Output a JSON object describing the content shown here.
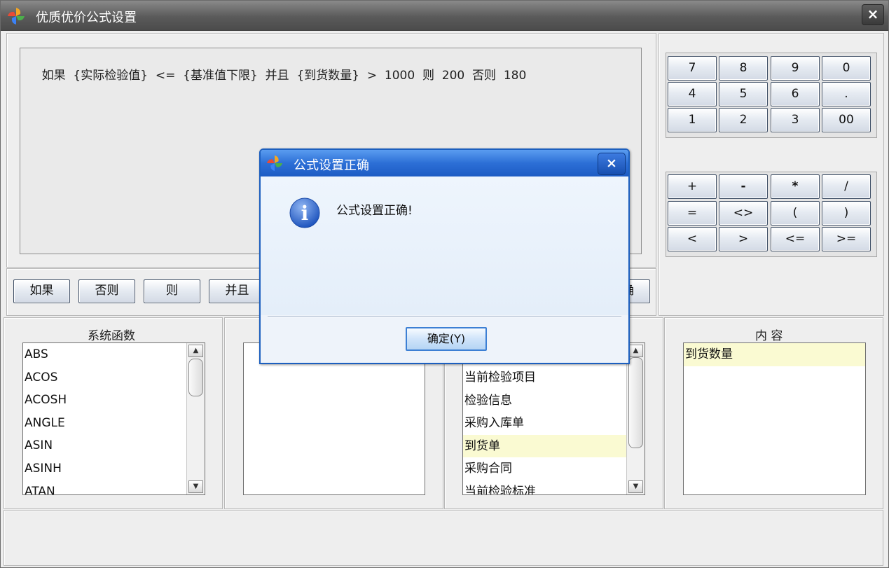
{
  "window": {
    "title": "优质优价公式设置",
    "close_symbol": "×"
  },
  "formula": {
    "text": "如果  {实际检验值}  <=  {基准值下限}  并且  {到货数量}  >  1000  则  200  否则  180"
  },
  "keypad_digits": [
    "7",
    "8",
    "9",
    "0",
    "4",
    "5",
    "6",
    ".",
    "1",
    "2",
    "3",
    "00"
  ],
  "keypad_ops": [
    "+",
    "-",
    "*",
    "/",
    "=",
    "<>",
    "(",
    ")",
    "<",
    ">",
    "<=",
    ">="
  ],
  "logic_buttons": [
    "如果",
    "否则",
    "则",
    "并且"
  ],
  "logic_partial_label": "确",
  "functions": {
    "label": "系统函数",
    "items": [
      "ABS",
      "ACOS",
      "ACOSH",
      "ANGLE",
      "ASIN",
      "ASINH",
      "ATAN"
    ]
  },
  "categories": {
    "items": [
      "当前检验项目",
      "检验信息",
      "采购入库单",
      "到货单",
      "采购合同",
      "当前检验标准"
    ],
    "selected": "到货单"
  },
  "content": {
    "label": "内 容",
    "items": [
      "到货数量"
    ],
    "selected": "到货数量"
  },
  "dialog": {
    "title": "公式设置正确",
    "message": "公式设置正确!",
    "ok_label": "确定(Y)",
    "close_symbol": "×",
    "info_icon_text": "i"
  },
  "colors": {
    "title_bar": "#5a5a5a",
    "dialog_title": "#2c6fd6",
    "selected_row": "#fafad2",
    "info_icon": "#2d63c8"
  }
}
